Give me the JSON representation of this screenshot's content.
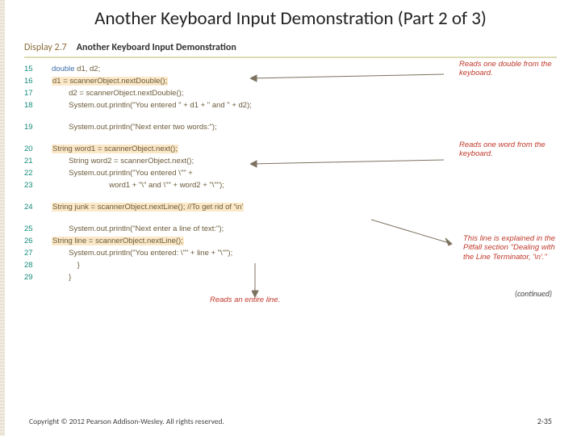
{
  "title": "Another Keyboard Input Demonstration (Part 2 of 3)",
  "display": {
    "label": "Display 2.7",
    "heading": "Another Keyboard Input Demonstration"
  },
  "code": [
    {
      "n": "15",
      "plain": "double d1, d2;",
      "kw": "double"
    },
    {
      "n": "16",
      "hl": "d1 = scannerObject.nextDouble();"
    },
    {
      "n": "17",
      "plain": "d2 = scannerObject.nextDouble();"
    },
    {
      "n": "18",
      "plain": "System.out.println(\"You entered \" + d1 + \" and \" + d2);"
    },
    {
      "gap": true
    },
    {
      "n": "19",
      "plain": "System.out.println(\"Next enter two words:\");"
    },
    {
      "gap": true
    },
    {
      "n": "20",
      "hl": "String word1 = scannerObject.next();"
    },
    {
      "n": "21",
      "plain": "String word2 = scannerObject.next();"
    },
    {
      "n": "22",
      "plain": "System.out.println(\"You entered \\\"\" +"
    },
    {
      "n": "23",
      "plain": "                   word1 + \"\\\" and \\\"\" + word2 + \"\\\"\");"
    },
    {
      "gap": true
    },
    {
      "n": "24",
      "hl": "String junk = scannerObject.nextLine(); //To get rid of '\\n'"
    },
    {
      "gap": true
    },
    {
      "n": "25",
      "plain": "System.out.println(\"Next enter a line of text:\");"
    },
    {
      "n": "26",
      "hl": "String line = scannerObject.nextLine();"
    },
    {
      "n": "27",
      "plain": "System.out.println(\"You entered: \\\"\" + line + \"\\\"\");"
    },
    {
      "n": "28",
      "plain": "    }"
    },
    {
      "n": "29",
      "plain": "}"
    }
  ],
  "annotations": {
    "a1": "Reads one double from the keyboard.",
    "a2": "Reads one word from the keyboard.",
    "a3": "This line is explained in the Pitfall section \"Dealing with the Line Terminator, '\\n'.\"",
    "a4": "Reads an entire line."
  },
  "continued": "(continued)",
  "copyright": "Copyright © 2012 Pearson Addison-Wesley. All rights reserved.",
  "pagenum": "2-35"
}
